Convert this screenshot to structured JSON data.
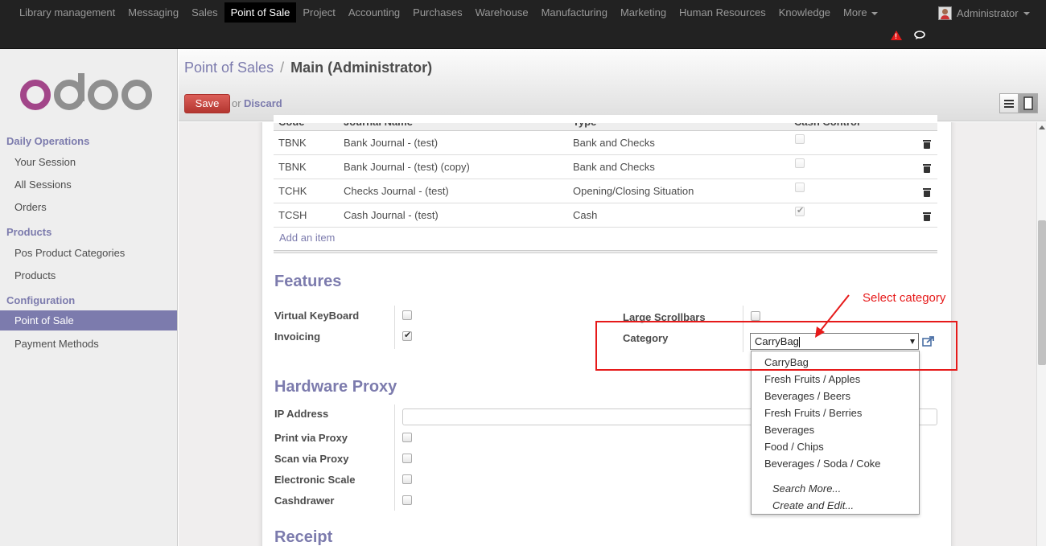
{
  "topbar": {
    "menu": [
      "Library management",
      "Messaging",
      "Sales",
      "Point of Sale",
      "Project",
      "Accounting",
      "Purchases",
      "Warehouse",
      "Manufacturing",
      "Marketing",
      "Human Resources",
      "Knowledge",
      "More"
    ],
    "active": "Point of Sale",
    "user": "Administrator"
  },
  "sidebar": {
    "logo_text": "odoo",
    "sections": [
      {
        "title": "Daily Operations",
        "items": [
          "Your Session",
          "All Sessions",
          "Orders"
        ]
      },
      {
        "title": "Products",
        "items": [
          "Pos Product Categories",
          "Products"
        ]
      },
      {
        "title": "Configuration",
        "items": [
          "Point of Sale",
          "Payment Methods"
        ]
      }
    ],
    "active_item": "Point of Sale"
  },
  "header": {
    "breadcrumb_parent": "Point of Sales",
    "separator": "/",
    "breadcrumb_current": "Main (Administrator)",
    "save": "Save",
    "or": "or",
    "discard": "Discard"
  },
  "journals": {
    "columns": [
      "Code",
      "Journal Name",
      "Type",
      "Cash Control"
    ],
    "rows": [
      {
        "code": "TBNK",
        "name": "Bank Journal - (test)",
        "type": "Bank and Checks",
        "cash_control": false
      },
      {
        "code": "TBNK",
        "name": "Bank Journal - (test) (copy)",
        "type": "Bank and Checks",
        "cash_control": false
      },
      {
        "code": "TCHK",
        "name": "Checks Journal - (test)",
        "type": "Opening/Closing Situation",
        "cash_control": false
      },
      {
        "code": "TCSH",
        "name": "Cash Journal - (test)",
        "type": "Cash",
        "cash_control": true
      }
    ],
    "add_item": "Add an item"
  },
  "features": {
    "title": "Features",
    "virtual_keyboard": "Virtual KeyBoard",
    "invoicing": "Invoicing",
    "large_scrollbars": "Large Scrollbars",
    "category": "Category",
    "category_value": "CarryBag"
  },
  "hardware": {
    "title": "Hardware Proxy",
    "ip_address": "IP Address",
    "print_via_proxy": "Print via Proxy",
    "scan_via_proxy": "Scan via Proxy",
    "electronic_scale": "Electronic Scale",
    "cashdrawer": "Cashdrawer"
  },
  "receipt": {
    "title": "Receipt"
  },
  "dropdown": {
    "options": [
      "CarryBag",
      "Fresh Fruits / Apples",
      "Beverages / Beers",
      "Fresh Fruits / Berries",
      "Beverages",
      "Food / Chips",
      "Beverages / Soda / Coke"
    ],
    "search_more": "Search More...",
    "create_edit": "Create and Edit..."
  },
  "annotation": {
    "text": "Select category",
    "color": "#e61a1a"
  },
  "colors": {
    "accent": "#7c7bad",
    "save": "#d9534f"
  }
}
